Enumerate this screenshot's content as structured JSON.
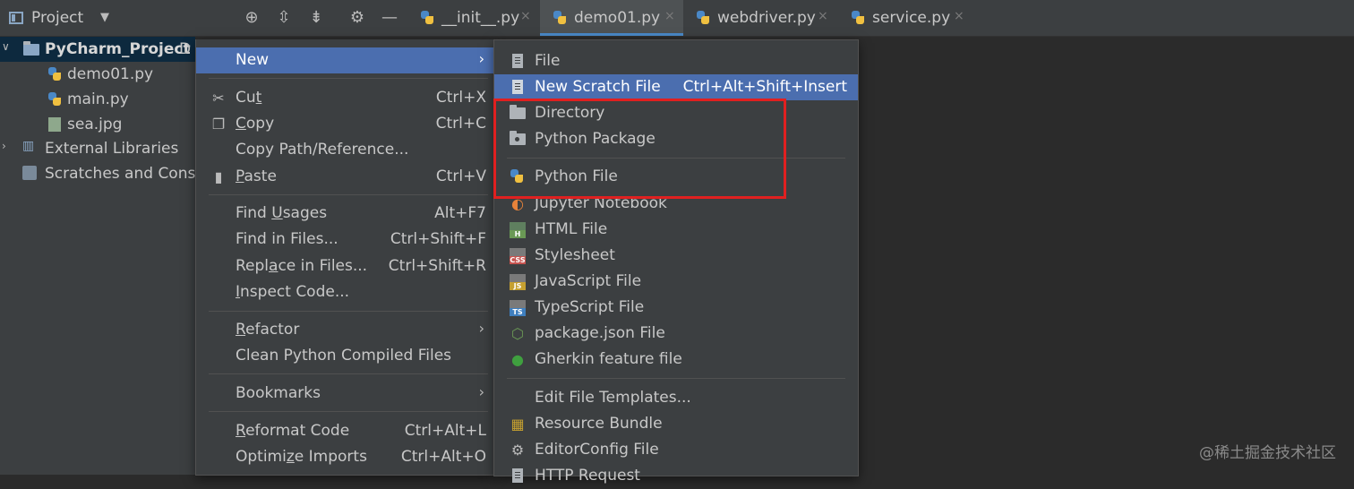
{
  "project_panel": {
    "title": "Project",
    "dropdown_caret": "▼"
  },
  "toolbar_icons": [
    "locate-icon",
    "expand-all-icon",
    "collapse-all-icon",
    "gear-icon",
    "minimize-icon"
  ],
  "tabs": [
    {
      "label": "__init__.py",
      "active": false
    },
    {
      "label": "demo01.py",
      "active": true
    },
    {
      "label": "webdriver.py",
      "active": false
    },
    {
      "label": "service.py",
      "active": false
    }
  ],
  "tab_close_glyph": "×",
  "tree": {
    "root": {
      "label": "PyCharm_Project",
      "suffix": "D"
    },
    "files": [
      "demo01.py",
      "main.py",
      "sea.jpg"
    ],
    "external_libraries": "External Libraries",
    "scratches": "Scratches and Conso"
  },
  "context_menu": {
    "new": "New",
    "cut": {
      "pre": "Cu",
      "u": "t",
      "post": "",
      "shortcut": "Ctrl+X"
    },
    "copy": {
      "pre": "",
      "u": "C",
      "post": "opy",
      "shortcut": "Ctrl+C"
    },
    "copy_path": "Copy Path/Reference...",
    "paste": {
      "pre": "",
      "u": "P",
      "post": "aste",
      "shortcut": "Ctrl+V"
    },
    "find_usages": {
      "pre": "Find ",
      "u": "U",
      "post": "sages",
      "shortcut": "Alt+F7"
    },
    "find_in_files": {
      "label": "Find in Files...",
      "shortcut": "Ctrl+Shift+F"
    },
    "replace_in_files": {
      "pre": "Repl",
      "u": "a",
      "post": "ce in Files...",
      "shortcut": "Ctrl+Shift+R"
    },
    "inspect_code": {
      "pre": "",
      "u": "I",
      "post": "nspect Code..."
    },
    "refactor": {
      "pre": "",
      "u": "R",
      "post": "efactor"
    },
    "clean_compiled": "Clean Python Compiled Files",
    "bookmarks": "Bookmarks",
    "reformat_code": {
      "pre": "",
      "u": "R",
      "post": "eformat Code",
      "shortcut": "Ctrl+Alt+L"
    },
    "optimize_imports": {
      "pre": "Optimi",
      "u": "z",
      "post": "e Imports",
      "shortcut": "Ctrl+Alt+O"
    }
  },
  "new_submenu": {
    "file": "File",
    "scratch": {
      "label": "New Scratch File",
      "shortcut": "Ctrl+Alt+Shift+Insert"
    },
    "directory": "Directory",
    "python_package": "Python Package",
    "python_file": "Python File",
    "jupyter": "Jupyter Notebook",
    "html": "HTML File",
    "stylesheet": "Stylesheet",
    "javascript": "JavaScript File",
    "typescript": "TypeScript File",
    "package_json": "package.json File",
    "gherkin": "Gherkin feature file",
    "edit_templates": "Edit File Templates...",
    "resource_bundle": "Resource Bundle",
    "editorconfig": "EditorConfig File",
    "http_request": "HTTP Request"
  },
  "icon_badges": {
    "html": "H",
    "css": "CSS",
    "js": "JS",
    "ts": "TS"
  },
  "colors": {
    "highlight": "#4b6eaf",
    "annotation_box": "#e02020",
    "active_tab_underline": "#4a88c7"
  },
  "watermark": "@稀土掘金技术社区"
}
